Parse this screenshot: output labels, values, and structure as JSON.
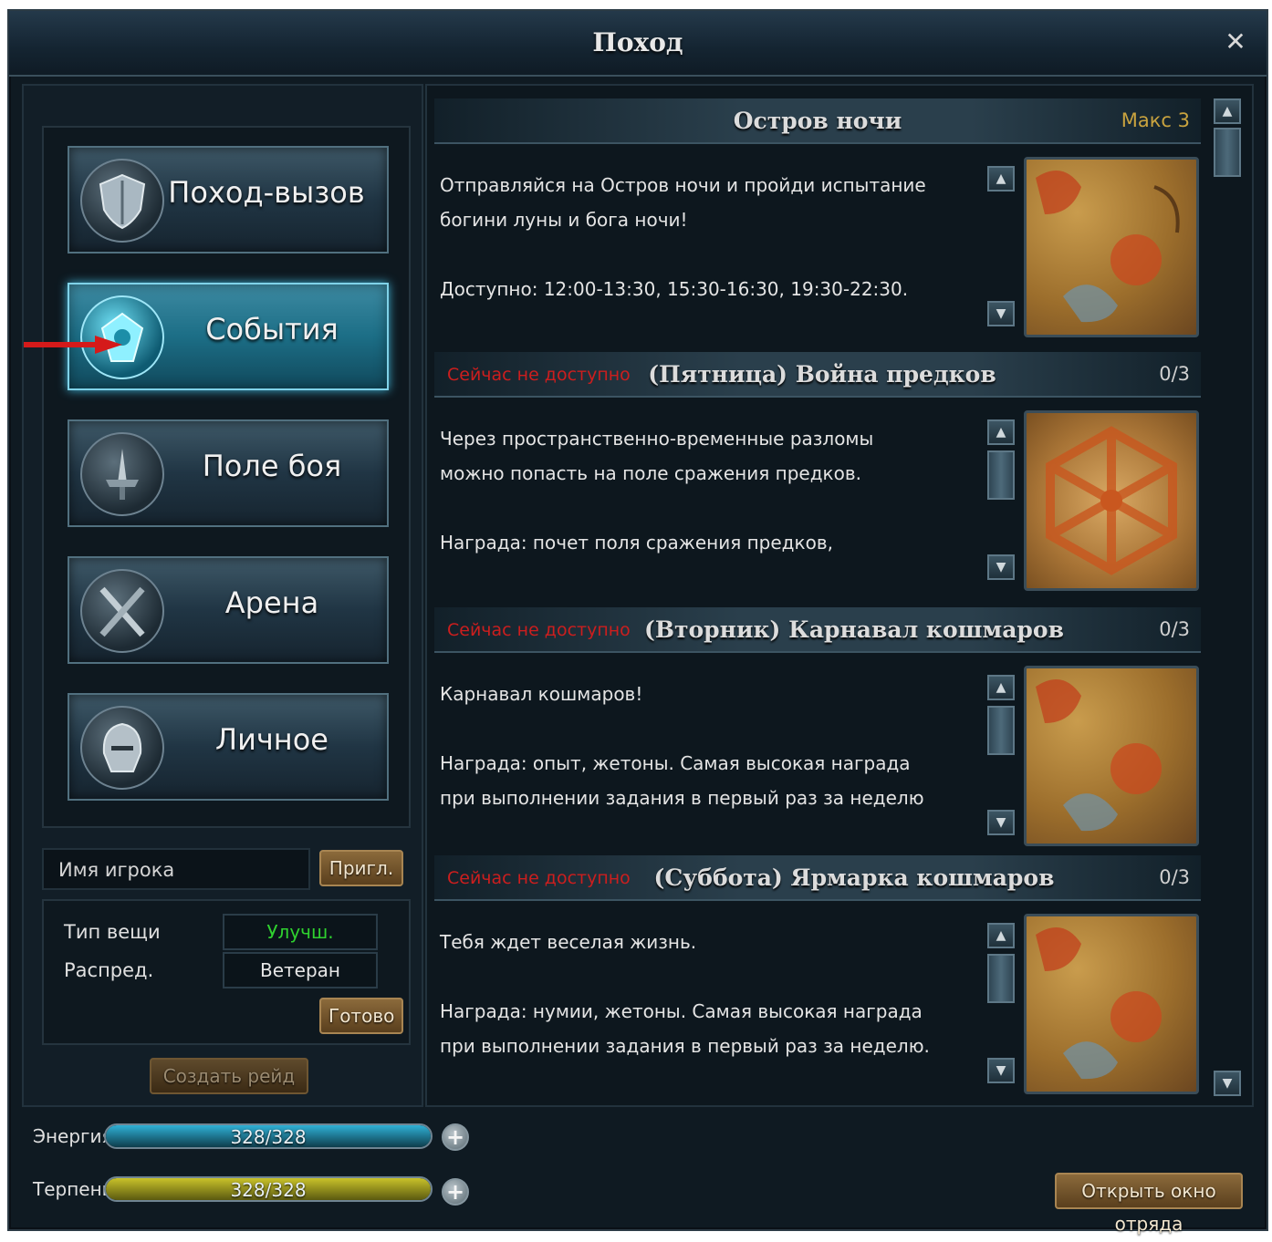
{
  "window": {
    "title": "Поход"
  },
  "nav": [
    {
      "label": "Поход-вызов",
      "icon": "shield-icon"
    },
    {
      "label": "События",
      "icon": "event-emblem-icon",
      "active": true
    },
    {
      "label": "Поле боя",
      "icon": "sword-icon"
    },
    {
      "label": "Арена",
      "icon": "crossed-swords-icon"
    },
    {
      "label": "Личное",
      "icon": "helmet-icon"
    }
  ],
  "player": {
    "placeholder": "Имя игрока",
    "invite_label": "Пригл."
  },
  "loot": {
    "item_type_label": "Тип вещи",
    "item_type_value": "Улучш.",
    "distribution_label": "Распред.",
    "distribution_value": "Ветеран",
    "ready_label": "Готово"
  },
  "raid_label": "Создать рейд",
  "events": [
    {
      "title": "Остров ночи",
      "max": "Макс 3",
      "description": "Отправляйся на Остров ночи и пройди испытание\nбогини луны и бога ночи!\n\nДоступно: 12:00-13:30, 15:30-16:30, 19:30-22:30."
    },
    {
      "status": "Сейчас не доступно",
      "title": "(Пятница) Война предков",
      "count": "0/3",
      "description": "Через пространственно-временные разломы\nможно попасть на поле сражения предков.\n\nНаграда: почет поля сражения предков,"
    },
    {
      "status": "Сейчас не доступно",
      "title": "(Вторник) Карнавал кошмаров",
      "count": "0/3",
      "description": "Карнавал кошмаров!\n\nНаграда: опыт, жетоны. Самая высокая награда\nпри выполнении задания в первый раз за неделю"
    },
    {
      "status": "Сейчас не доступно",
      "title": "(Суббота) Ярмарка кошмаров",
      "count": "0/3",
      "description": "Тебя ждет веселая жизнь.\n\nНаграда: нумии, жетоны. Самая высокая награда\nпри выполнении задания в первый раз за неделю."
    }
  ],
  "energy": {
    "label": "Энергия",
    "value": "328/328",
    "fraction": 1.0,
    "color": "#2fb1d6"
  },
  "patience": {
    "label": "Терпение",
    "value": "328/328",
    "fraction": 1.0,
    "color": "#c9c22a"
  },
  "squad_label": "Открыть окно отряда",
  "colors": {
    "unavailable": "#cc1e1e",
    "max": "#c9a33f",
    "upgrade": "#2fd12f",
    "accent": "#3fb0d3"
  }
}
